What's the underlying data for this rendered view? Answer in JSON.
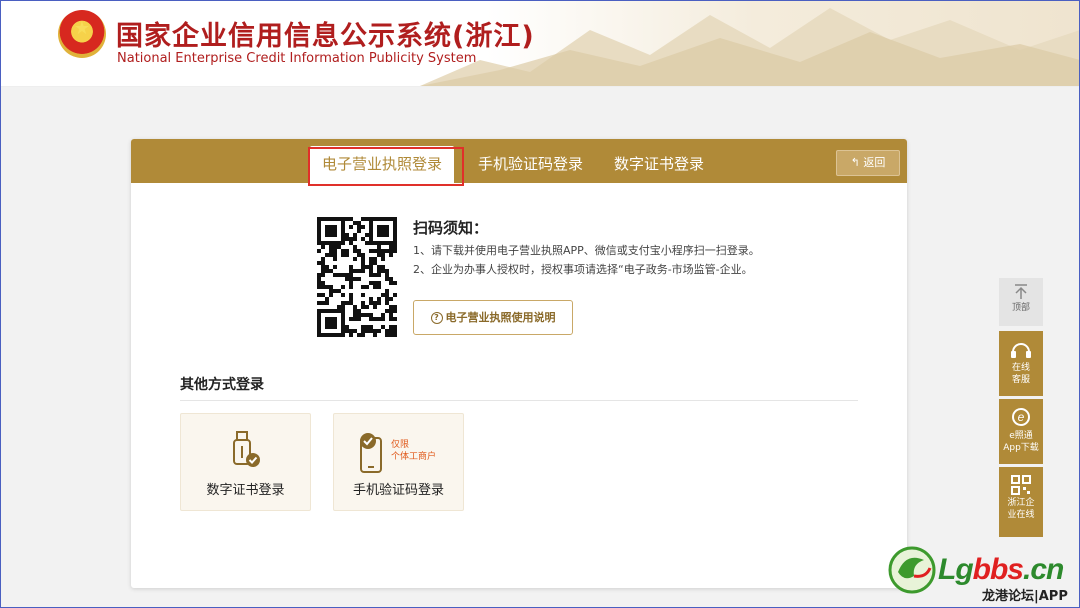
{
  "header": {
    "title_cn": "国家企业信用信息公示系统(浙江)",
    "title_en": "National Enterprise Credit Information Publicity System"
  },
  "login": {
    "tabs": [
      {
        "label": "电子营业执照登录",
        "active": true
      },
      {
        "label": "手机验证码登录",
        "active": false
      },
      {
        "label": "数字证书登录",
        "active": false
      }
    ],
    "back_label": "返回",
    "scan_title": "扫码须知：",
    "scan_lines": [
      "1、请下载并使用电子营业执照APP、微信或支付宝小程序扫一扫登录。",
      "2、企业为办事人授权时，授权事项请选择“电子政务-市场监管-企业。"
    ],
    "manual_button": "电子营业执照使用说明",
    "other_title": "其他方式登录",
    "options": [
      {
        "label": "数字证书登录",
        "icon": "usb-key-icon"
      },
      {
        "label": "手机验证码登录",
        "icon": "phone-check-icon",
        "note_line1": "仅限",
        "note_line2": "个体工商户"
      }
    ]
  },
  "sidebar": {
    "top_label": "顶部",
    "items": [
      {
        "label_line1": "在线",
        "label_line2": "客服",
        "icon": "headset-icon"
      },
      {
        "label_line1": "e照通",
        "label_line2": "App下载",
        "icon": "e-app-icon"
      },
      {
        "label_line1": "浙江企",
        "label_line2": "业在线",
        "icon": "qr-icon"
      }
    ]
  },
  "watermark": {
    "brand_green": "Lg",
    "brand_red": "bbs",
    "brand_tail": ".cn",
    "sub": "龙港论坛|APP"
  },
  "colors": {
    "accent_gold": "#b08a38",
    "title_red": "#b01e1e",
    "highlight_red": "#e0302a"
  }
}
